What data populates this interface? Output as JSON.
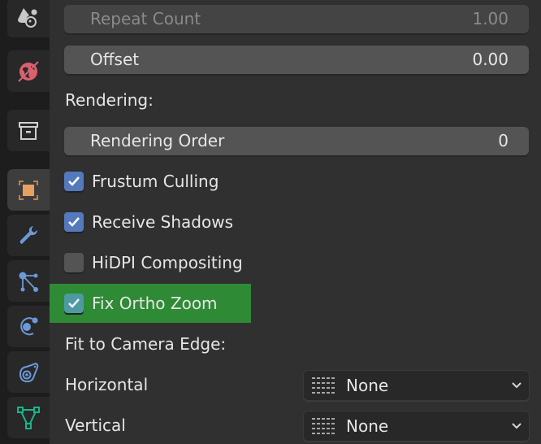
{
  "sidebar": {
    "tabs": [
      {
        "name": "shading",
        "icon": "shading-icon",
        "active": false
      },
      {
        "name": "world",
        "icon": "world-icon",
        "active": false
      },
      {
        "name": "collection",
        "icon": "collection-icon",
        "active": false
      },
      {
        "name": "object",
        "icon": "object-icon",
        "active": true
      },
      {
        "name": "modifiers",
        "icon": "wrench-icon",
        "active": false
      },
      {
        "name": "particles",
        "icon": "particles-icon",
        "active": false
      },
      {
        "name": "physics",
        "icon": "physics-icon",
        "active": false
      },
      {
        "name": "constraints",
        "icon": "constraints-icon",
        "active": false
      },
      {
        "name": "data",
        "icon": "mesh-data-icon",
        "active": false
      }
    ]
  },
  "fields": {
    "repeat_count": {
      "label": "Repeat Count",
      "value": "1.00",
      "disabled": true
    },
    "offset": {
      "label": "Offset",
      "value": "0.00"
    },
    "rendering_order": {
      "label": "Rendering Order",
      "value": "0"
    }
  },
  "sections": {
    "rendering": "Rendering:",
    "fit_to_camera_edge": "Fit to Camera Edge:"
  },
  "checkboxes": [
    {
      "label": "Frustum Culling",
      "checked": true
    },
    {
      "label": "Receive Shadows",
      "checked": true
    },
    {
      "label": "HiDPI Compositing",
      "checked": false
    },
    {
      "label": "Fix Ortho Zoom",
      "checked": true,
      "highlighted": true
    }
  ],
  "dropdowns": {
    "horizontal": {
      "label": "Horizontal",
      "value": "None"
    },
    "vertical": {
      "label": "Vertical",
      "value": "None"
    }
  },
  "colors": {
    "accent_blue": "#5479bd",
    "highlight_green": "#2f8a35",
    "object_orange": "#e8a060",
    "world_red": "#d9616e",
    "modifier_blue": "#6b9ad9",
    "data_green": "#19b58c"
  }
}
